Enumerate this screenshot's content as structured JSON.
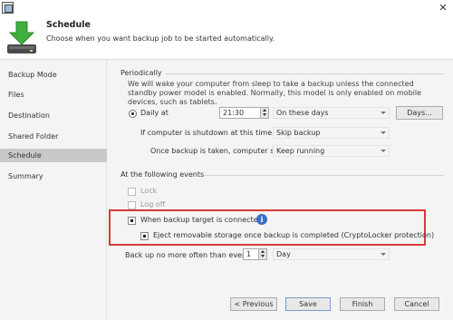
{
  "header": {
    "title": "Schedule",
    "subtitle": "Choose when you want backup job to be started automatically."
  },
  "sidebar": {
    "items": [
      {
        "label": "Backup Mode",
        "active": false
      },
      {
        "label": "Files",
        "active": false
      },
      {
        "label": "Destination",
        "active": false
      },
      {
        "label": "Shared Folder",
        "active": false
      },
      {
        "label": "Schedule",
        "active": true
      },
      {
        "label": "Summary",
        "active": false
      }
    ]
  },
  "periodically": {
    "group_label": "Periodically",
    "note": "We will wake your computer from sleep to take a backup unless the connected standby power model is enabled. Normally, this model is only enabled on mobile devices, such as tablets.",
    "daily_label": "Daily at",
    "time_value": "21:30",
    "days_select": "On these days",
    "days_button": "Days...",
    "shutdown_label": "If computer is shutdown at this time",
    "shutdown_select": "Skip backup",
    "after_label": "Once backup is taken, computer should",
    "after_select": "Keep running"
  },
  "events": {
    "group_label": "At the following events",
    "lock_label": "Lock",
    "logoff_label": "Log off",
    "target_label": "When backup target is connected",
    "info_glyph": "i",
    "eject_label": "Eject removable storage once backup is completed (CryptoLocker protection)",
    "limit_label": "Back up no more often than every",
    "limit_value": "1",
    "limit_unit": "Day"
  },
  "footer": {
    "previous": "< Previous",
    "save": "Save",
    "finish": "Finish",
    "cancel": "Cancel"
  },
  "colors": {
    "highlight": "#d93a3a",
    "selected_nav": "#c9c9c9",
    "info_icon": "#3c6ec7"
  }
}
